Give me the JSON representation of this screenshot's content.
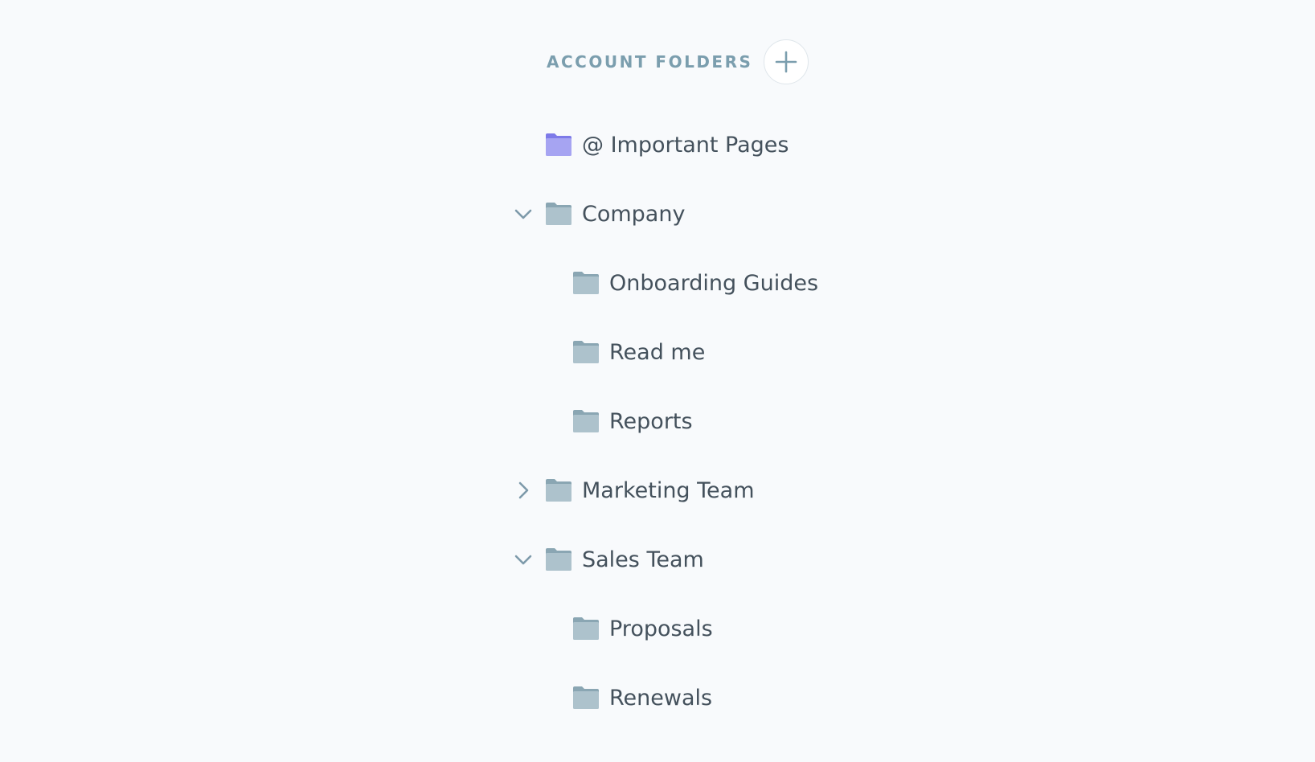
{
  "header": {
    "title": "ACCOUNT FOLDERS",
    "add_icon": "plus-icon"
  },
  "colors": {
    "background": "#f8fafc",
    "header_text": "#7b9eae",
    "label_text": "#44515c",
    "folder_default": "#adc2cc",
    "folder_default_tab": "#8aa6b3",
    "folder_special": "#a6a4f2",
    "folder_special_tab": "#7d7ae8",
    "chevron": "#7d9aaa"
  },
  "folders": [
    {
      "label": "@ Important Pages",
      "icon": "folder-icon-special",
      "chevron": "none",
      "level": 0
    },
    {
      "label": "Company",
      "icon": "folder-icon",
      "chevron": "expanded",
      "level": 0
    },
    {
      "label": "Onboarding Guides",
      "icon": "folder-icon",
      "chevron": "none",
      "level": 1
    },
    {
      "label": "Read me",
      "icon": "folder-icon",
      "chevron": "none",
      "level": 1
    },
    {
      "label": "Reports",
      "icon": "folder-icon",
      "chevron": "none",
      "level": 1
    },
    {
      "label": "Marketing Team",
      "icon": "folder-icon",
      "chevron": "collapsed",
      "level": 0
    },
    {
      "label": "Sales Team",
      "icon": "folder-icon",
      "chevron": "expanded",
      "level": 0
    },
    {
      "label": "Proposals",
      "icon": "folder-icon",
      "chevron": "none",
      "level": 1
    },
    {
      "label": "Renewals",
      "icon": "folder-icon",
      "chevron": "none",
      "level": 1
    }
  ]
}
